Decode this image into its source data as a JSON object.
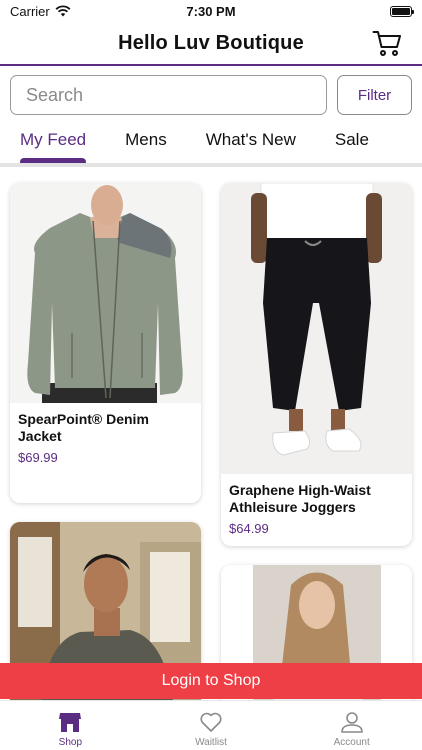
{
  "status_bar": {
    "carrier": "Carrier",
    "time": "7:30 PM"
  },
  "header": {
    "title": "Hello Luv Boutique"
  },
  "search": {
    "placeholder": "Search",
    "value": "",
    "filter_label": "Filter"
  },
  "tabs": [
    {
      "label": "My Feed",
      "active": true
    },
    {
      "label": "Mens",
      "active": false
    },
    {
      "label": "What's New",
      "active": false
    },
    {
      "label": "Sale",
      "active": false
    }
  ],
  "products": [
    {
      "title": "SpearPoint® Denim Jacket",
      "price": "$69.99",
      "image": "denim-jacket-photo"
    },
    {
      "title": "Graphene High-Waist Athleisure Joggers",
      "price": "$64.99",
      "image": "joggers-photo"
    },
    {
      "title": "",
      "price": "",
      "image": "man-sweater-photo"
    },
    {
      "title": "",
      "price": "",
      "image": "woman-floral-top-photo"
    }
  ],
  "login_banner": {
    "label": "Login to Shop"
  },
  "tabbar": [
    {
      "label": "Shop",
      "icon": "storefront-icon",
      "active": true
    },
    {
      "label": "Waitlist",
      "icon": "heart-icon",
      "active": false
    },
    {
      "label": "Account",
      "icon": "person-icon",
      "active": false
    }
  ],
  "colors": {
    "accent": "#5a2d82",
    "banner": "#ee3e46"
  }
}
